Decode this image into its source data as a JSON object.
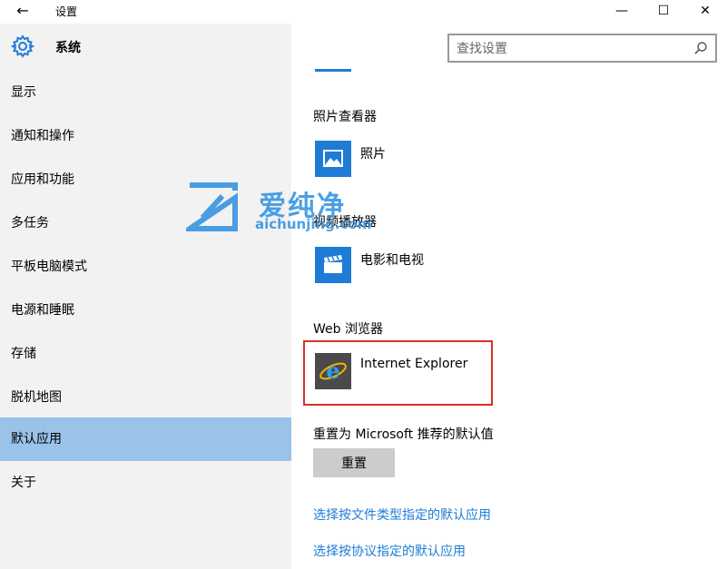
{
  "window": {
    "title": "设置",
    "back_glyph": "←",
    "minimize_glyph": "—",
    "maximize_glyph": "☐",
    "close_glyph": "✕"
  },
  "sidebar": {
    "header": {
      "icon": "gear-icon",
      "label": "系统"
    },
    "items": [
      {
        "label": "显示"
      },
      {
        "label": "通知和操作"
      },
      {
        "label": "应用和功能"
      },
      {
        "label": "多任务"
      },
      {
        "label": "平板电脑模式"
      },
      {
        "label": "电源和睡眠"
      },
      {
        "label": "存储"
      },
      {
        "label": "脱机地图"
      },
      {
        "label": "默认应用",
        "active": true
      },
      {
        "label": "关于"
      }
    ]
  },
  "search": {
    "placeholder": "查找设置",
    "icon": "search-icon"
  },
  "content": {
    "sections": [
      {
        "title": "照片查看器",
        "app": "照片",
        "icon": "photos-icon"
      },
      {
        "title": "视频播放器",
        "app": "电影和电视",
        "icon": "movies-tv-icon"
      },
      {
        "title": "Web 浏览器",
        "app": "Internet Explorer",
        "icon": "internet-explorer-icon"
      }
    ],
    "reset_label": "重置为 Microsoft 推荐的默认值",
    "reset_button": "重置",
    "links": [
      "选择按文件类型指定的默认应用",
      "选择按协议指定的默认应用"
    ]
  },
  "watermark": {
    "text": "爱纯净",
    "url": "aichunjing.com"
  },
  "colors": {
    "accent": "#1e7cd6",
    "sidebar_bg": "#f2f2f2",
    "active_item": "#99c3e9",
    "highlight_border": "#d9302c",
    "button_bg": "#cccccc"
  }
}
